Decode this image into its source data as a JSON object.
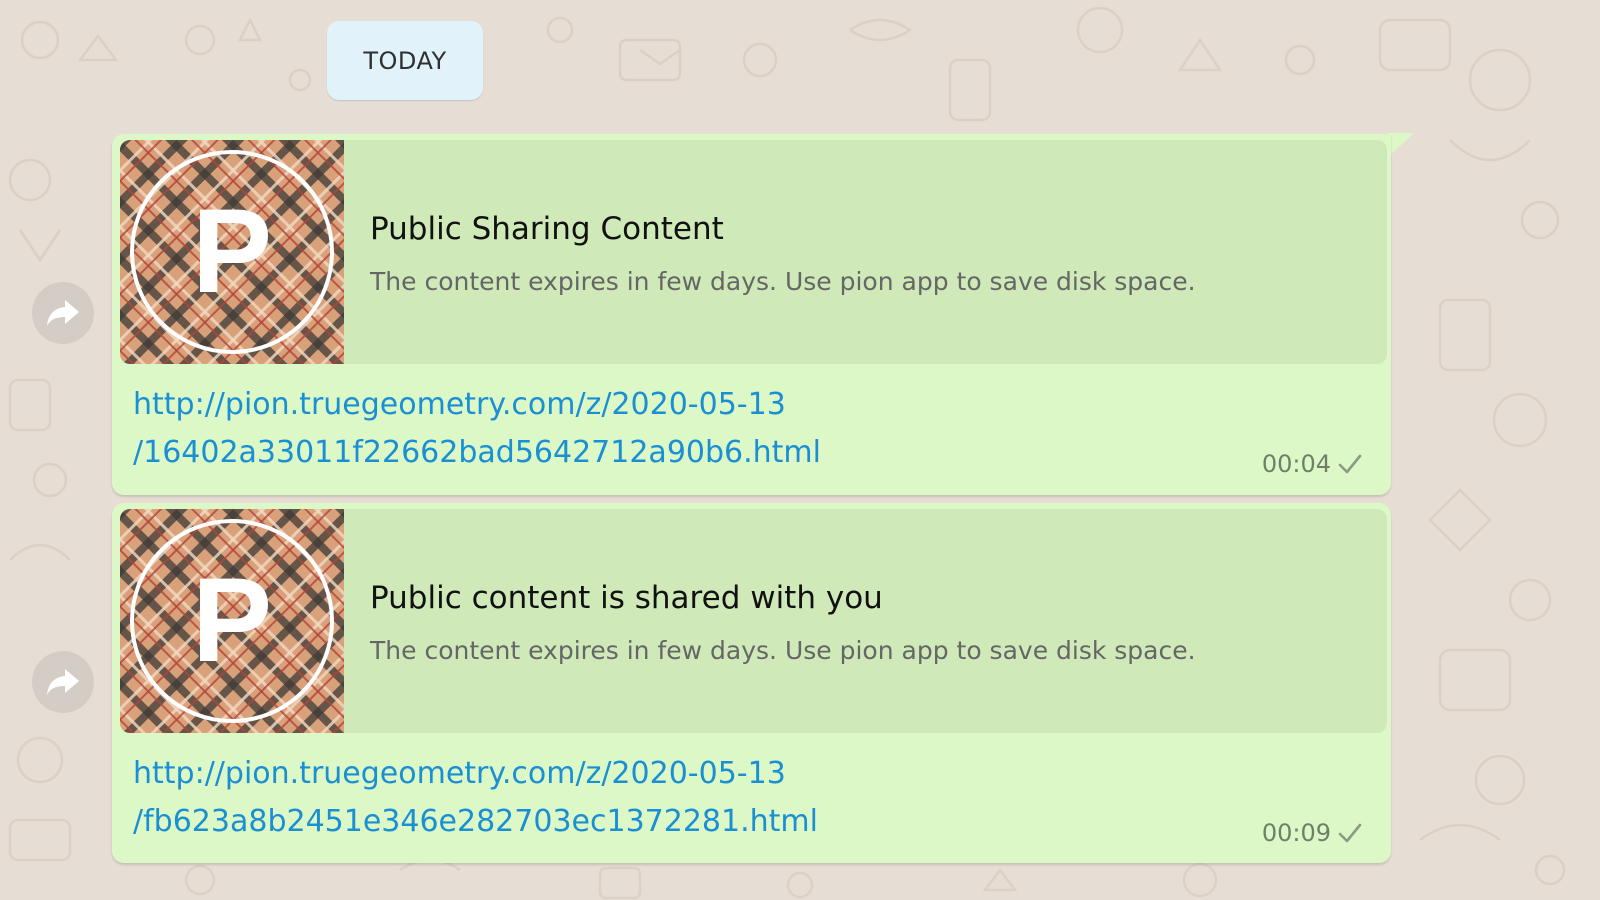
{
  "chat": {
    "date_label": "TODAY",
    "colors": {
      "background": "#e6ddd4",
      "outgoing_bubble": "#dcf8c6",
      "preview_panel": "#cfe9b9",
      "link": "#1b8fd3",
      "date_chip": "#e1f2fb"
    },
    "messages": [
      {
        "preview_title": "Public Sharing Content",
        "preview_description": "The content expires in few days. Use pion app to save disk space.",
        "thumb_letter": "P",
        "link_line1": "http://pion.truegeometry.com/z/2020-05-13",
        "link_line2": "/16402a33011f22662bad5642712a90b6.html",
        "time": "00:04",
        "status_icon": "single-check-icon",
        "forward_icon": "forward-icon"
      },
      {
        "preview_title": "Public content is shared with you",
        "preview_description": "The content expires in few days. Use pion app to save disk space.",
        "thumb_letter": "P",
        "link_line1": "http://pion.truegeometry.com/z/2020-05-13",
        "link_line2": "/fb623a8b2451e346e282703ec1372281.html",
        "time": "00:09",
        "status_icon": "single-check-icon",
        "forward_icon": "forward-icon"
      }
    ]
  }
}
